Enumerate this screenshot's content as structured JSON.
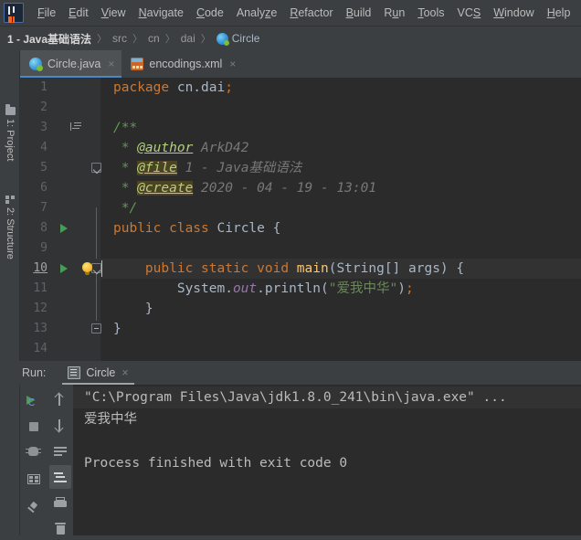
{
  "app": {
    "logo_icon": "intellij-idea-logo"
  },
  "menubar": {
    "items": [
      {
        "label": "File",
        "mnemonic": "F"
      },
      {
        "label": "Edit",
        "mnemonic": "E"
      },
      {
        "label": "View",
        "mnemonic": "V"
      },
      {
        "label": "Navigate",
        "mnemonic": "N"
      },
      {
        "label": "Code",
        "mnemonic": "C"
      },
      {
        "label": "Analyze",
        "mnemonic": "z"
      },
      {
        "label": "Refactor",
        "mnemonic": "R"
      },
      {
        "label": "Build",
        "mnemonic": "B"
      },
      {
        "label": "Run",
        "mnemonic": "R"
      },
      {
        "label": "Tools",
        "mnemonic": "T"
      },
      {
        "label": "VCS",
        "mnemonic": "S"
      },
      {
        "label": "Window",
        "mnemonic": "W"
      },
      {
        "label": "Help",
        "mnemonic": "H"
      }
    ]
  },
  "breadcrumb": {
    "project": "1 - Java基础语法",
    "items": [
      "src",
      "cn",
      "dai"
    ],
    "file": "Circle",
    "file_icon": "java-class-icon",
    "separator": "〉"
  },
  "tool_strip": {
    "project_label": "1: Project",
    "project_icon": "folder-icon",
    "structure_label": "2: Structure",
    "structure_icon": "structure-icon"
  },
  "editor_tabs": [
    {
      "label": "Circle.java",
      "icon": "java-class-icon",
      "active": true,
      "close": "×"
    },
    {
      "label": "encodings.xml",
      "icon": "xml-file-icon",
      "active": false,
      "close": "×"
    }
  ],
  "editor": {
    "line_numbers": [
      "1",
      "2",
      "3",
      "4",
      "5",
      "6",
      "7",
      "8",
      "9",
      "10",
      "11",
      "12",
      "13",
      "14"
    ],
    "current_line": 10,
    "lines": {
      "l1_kw": "package",
      "l1_pkg": " cn.dai",
      "l1_semi": ";",
      "l3": "/**",
      "l4_star": " * ",
      "l4_tag": "@author",
      "l4_text": " ArkD42",
      "l5_star": " * ",
      "l5_tag": "@file",
      "l5_text": " 1 - Java基础语法",
      "l6_star": " * ",
      "l6_tag": "@create",
      "l6_text": " 2020 - 04 - 19 - 13:01",
      "l7": " */",
      "l8_kw1": "public",
      "l8_kw2": " class",
      "l8_name": " Circle",
      "l8_brace": " {",
      "l10_kw": "    public static void",
      "l10_fn": " main",
      "l10_args": "(String[] args)",
      "l10_brace": " {",
      "l11_obj": "        System.",
      "l11_field": "out",
      "l11_call": ".println(",
      "l11_str": "\"爱我中华\"",
      "l11_close": ")",
      "l11_semi": ";",
      "l12": "    }",
      "l13": "}"
    }
  },
  "run_panel": {
    "label": "Run:",
    "tab_label": "Circle",
    "tab_icon": "run-config-icon",
    "tab_close": "×",
    "toolbar_left": [
      {
        "name": "rerun-button",
        "icon": "rerun-icon"
      },
      {
        "name": "stop-button",
        "icon": "stop-icon"
      },
      {
        "name": "rerun-failed-button",
        "icon": "debug-rerun-icon"
      },
      {
        "name": "layout-button",
        "icon": "layout-icon"
      },
      {
        "name": "pin-tab-button",
        "icon": "pin-icon"
      }
    ],
    "toolbar_right": [
      {
        "name": "up-button",
        "icon": "arrow-up-icon"
      },
      {
        "name": "down-button",
        "icon": "arrow-down-icon"
      },
      {
        "name": "soft-wrap-button",
        "icon": "soft-wrap-icon"
      },
      {
        "name": "scroll-to-end-button",
        "icon": "scroll-to-end-icon",
        "selected": true
      },
      {
        "name": "print-button",
        "icon": "print-icon"
      },
      {
        "name": "clear-all-button",
        "icon": "trash-icon"
      }
    ],
    "console": [
      "\"C:\\Program Files\\Java\\jdk1.8.0_241\\bin\\java.exe\" ...",
      "爱我中华",
      "",
      "Process finished with exit code 0"
    ]
  },
  "colors": {
    "keyword": "#cc7832",
    "string": "#6a8759",
    "comment": "#629755",
    "javadoc_tag": "#b2d17a",
    "method": "#ffc66d",
    "field": "#9876aa",
    "editor_bg": "#2b2b2b",
    "panel_bg": "#3c3f41",
    "accent": "#4a88c7",
    "run_green": "#499c54"
  }
}
